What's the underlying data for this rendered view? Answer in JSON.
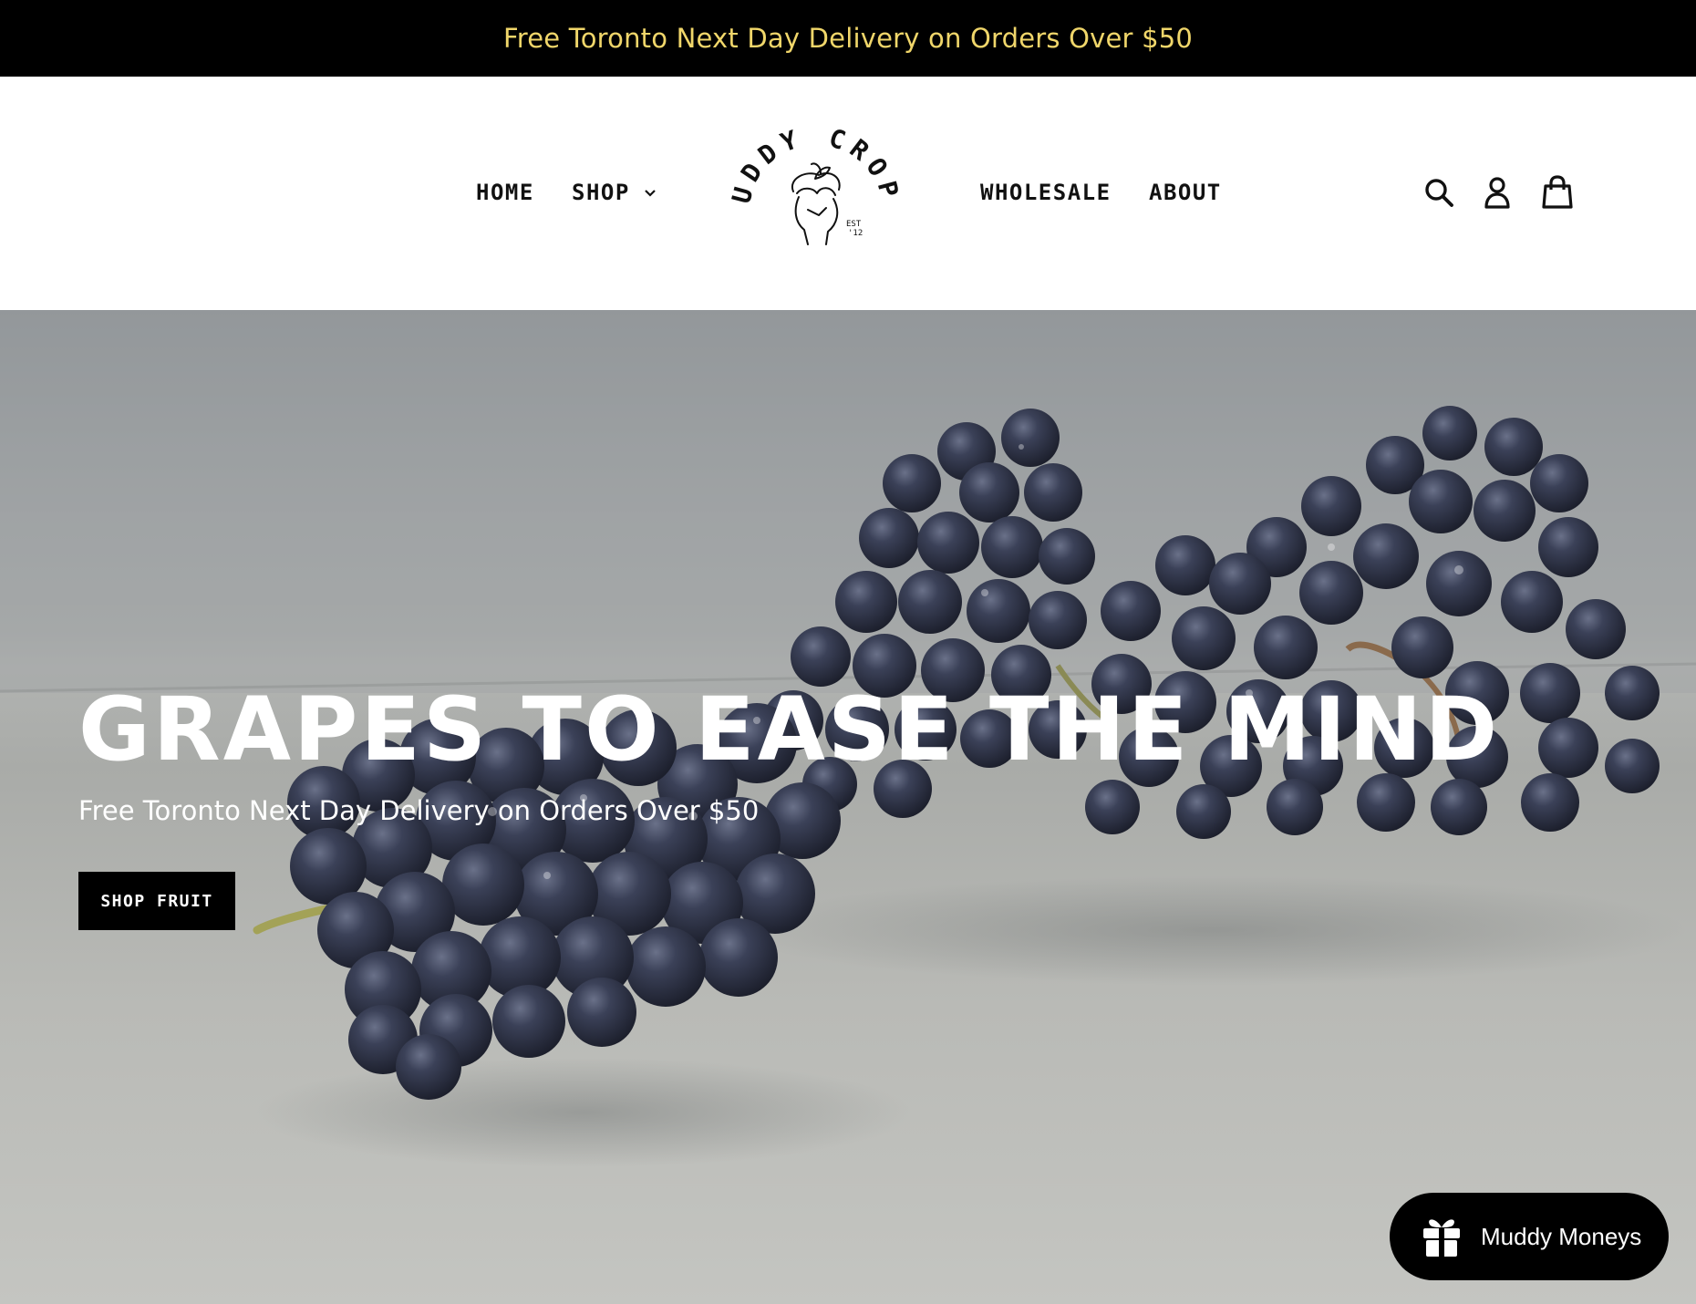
{
  "announcement": {
    "text": "Free Toronto Next Day Delivery on Orders Over $50"
  },
  "nav": {
    "home": "HOME",
    "shop": "SHOP",
    "wholesale": "WHOLESALE",
    "about": "ABOUT"
  },
  "logo": {
    "text": "MUDDY CROPS",
    "alt": "Muddy Crops"
  },
  "header_icons": [
    "search-icon",
    "account-icon",
    "cart-icon"
  ],
  "hero": {
    "title": "GRAPES TO EASE THE MIND",
    "subtitle": "Free Toronto Next Day Delivery on Orders Over $50",
    "button": "SHOP FRUIT"
  },
  "rewards": {
    "label": "Muddy Moneys",
    "icon": "gift-icon"
  },
  "colors": {
    "announcement_bg": "#000000",
    "announcement_text": "#f0d66a",
    "button_bg": "#000000",
    "grape": "#2f3447"
  }
}
